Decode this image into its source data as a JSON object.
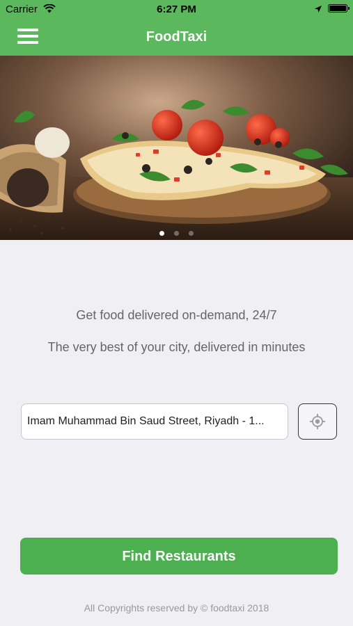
{
  "status_bar": {
    "carrier": "Carrier",
    "time": "6:27 PM",
    "icons": [
      "wifi-icon",
      "location-arrow-icon",
      "battery-icon"
    ]
  },
  "nav": {
    "title": "FoodTaxi",
    "menu_icon": "hamburger-menu-icon"
  },
  "hero": {
    "carousel_dots": 3,
    "active_index": 0
  },
  "taglines": {
    "line1": "Get food delivered on-demand, 24/7",
    "line2": "The very best of your city, delivered in minutes"
  },
  "address": {
    "value": "Imam Muhammad Bin Saud Street, Riyadh - 1...",
    "locate_icon": "crosshair-location-icon"
  },
  "actions": {
    "find_label": "Find Restaurants"
  },
  "footer": {
    "copyright": "All Copyrights reserved by © foodtaxi 2018"
  },
  "colors": {
    "brand_green": "#5cb85c",
    "button_green": "#4caf50",
    "background": "#efeff4"
  }
}
